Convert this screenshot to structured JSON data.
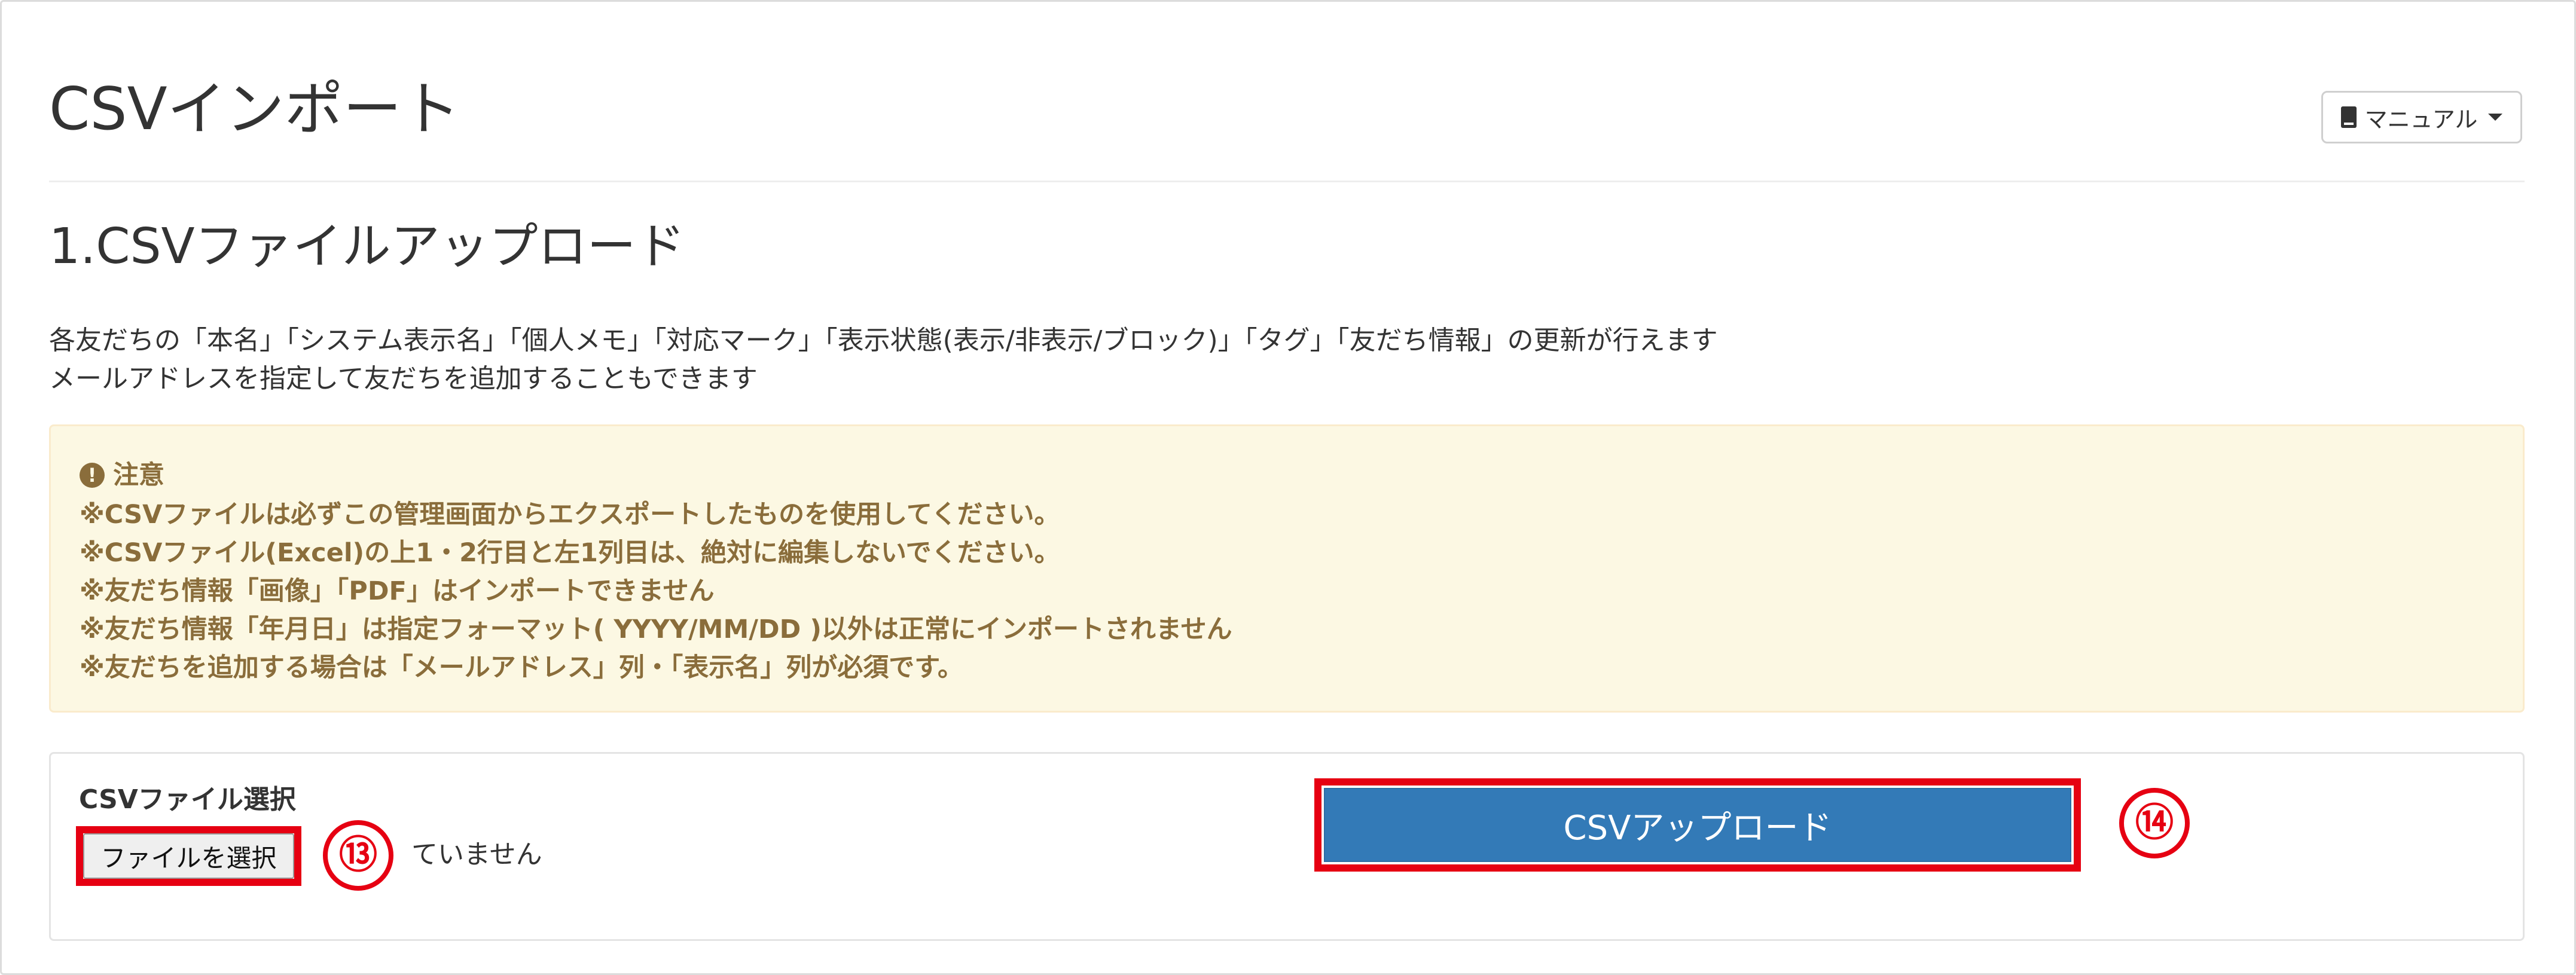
{
  "page": {
    "title": "CSVインポート",
    "manual_label": "マニュアル"
  },
  "section": {
    "title": "1.CSVファイルアップロード",
    "description": [
      "各友だちの「本名」「システム表示名」「個人メモ」「対応マーク」「表示状態(表示/非表示/ブロック)」「タグ」「友だち情報」の更新が行えます",
      "メールアドレスを指定して友だちを追加することもできます"
    ]
  },
  "notice": {
    "heading": "注意",
    "icon": "exclamation-circle-icon",
    "lines": [
      "※CSVファイルは必ずこの管理画面からエクスポートしたものを使用してください。",
      "※CSVファイル(Excel)の上1・2行目と左1列目は、絶対に編集しないでください。",
      "※友だち情報「画像」「PDF」はインポートできません",
      "※友だち情報「年月日」は指定フォーマット( YYYY/MM/DD )以外は正常にインポートされません",
      "※友だちを追加する場合は「メールアドレス」列・「表示名」列が必須です。"
    ]
  },
  "upload": {
    "file_label": "CSVファイル選択",
    "choose_file_label": "ファイルを選択",
    "no_file_text": "ていません",
    "upload_button_label": "CSVアップロード"
  },
  "annotations": {
    "marker_13": "⑬",
    "marker_14": "⑭",
    "highlight_color": "#e60012"
  },
  "colors": {
    "primary_button": "#337ab7",
    "warning_bg": "#fcf8e3",
    "warning_text": "#8a6d3b"
  }
}
